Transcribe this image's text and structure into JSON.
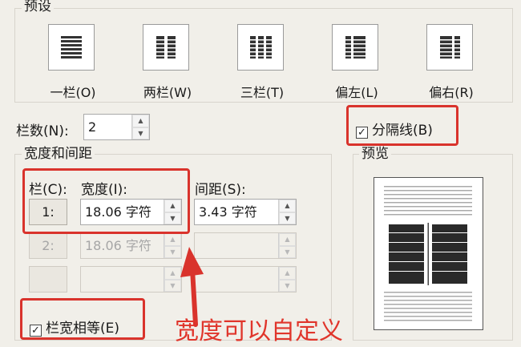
{
  "presets": {
    "title": "预设",
    "items": [
      {
        "label": "一栏(O)",
        "icon": "one-column-icon"
      },
      {
        "label": "两栏(W)",
        "icon": "two-column-icon"
      },
      {
        "label": "三栏(T)",
        "icon": "three-column-icon"
      },
      {
        "label": "偏左(L)",
        "icon": "left-column-icon"
      },
      {
        "label": "偏右(R)",
        "icon": "right-column-icon"
      }
    ]
  },
  "column_count": {
    "label": "栏数(N):",
    "value": "2"
  },
  "separator": {
    "label": "分隔线(B)",
    "checked": true
  },
  "width_spacing": {
    "title": "宽度和间距",
    "headers": {
      "column": "栏(C):",
      "width": "宽度(I):",
      "spacing": "间距(S):"
    },
    "rows": [
      {
        "num": "1:",
        "width": "18.06 字符",
        "spacing": "3.43 字符"
      },
      {
        "num": "2:",
        "width": "18.06 字符",
        "spacing": ""
      },
      {
        "num": "",
        "width": "",
        "spacing": ""
      }
    ]
  },
  "equal_width": {
    "label": "栏宽相等(E)",
    "checked": true
  },
  "preview": {
    "title": "预览"
  },
  "annotation": {
    "text": "宽度可以自定义",
    "color": "#e0352b"
  }
}
